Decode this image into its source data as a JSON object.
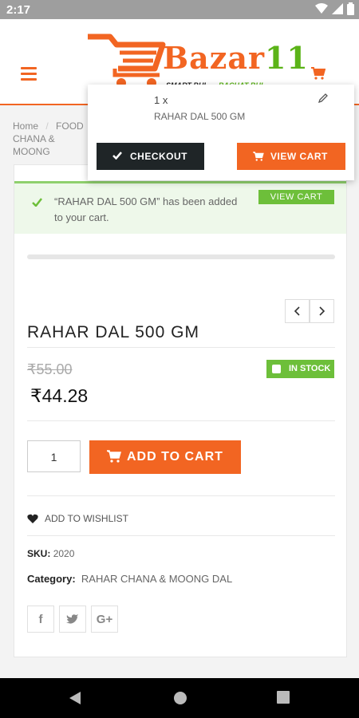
{
  "status": {
    "time": "2:17"
  },
  "brand": {
    "name": "Bazar",
    "number": "11",
    "tagline_left": "SMART BHI",
    "tagline_right": "BACHAT BHI"
  },
  "breadcrumb": {
    "home": "Home",
    "sep": "/",
    "section": "FOOD",
    "category": "CHANA & MOONG"
  },
  "notice": {
    "message": "“RAHAR DAL 500 GM” has been added to your cart.",
    "view_cart": "VIEW CART"
  },
  "product": {
    "title": "RAHAR DAL 500 GM",
    "old_price": "₹55.00",
    "price": "₹44.28",
    "stock": "IN STOCK",
    "quantity": "1",
    "add_to_cart": "ADD TO CART",
    "wishlist": "ADD TO WISHLIST",
    "sku_label": "SKU:",
    "sku": "2020",
    "category_label": "Category:",
    "category": "RAHAR CHANA & MOONG DAL"
  },
  "social": {
    "facebook": "f",
    "twitter": "t",
    "google": "G+"
  },
  "mini_cart": {
    "qty": "1",
    "times": "x",
    "item_name": "RAHAR DAL 500 GM",
    "checkout": "CHECKOUT",
    "view_cart": "VIEW CART"
  },
  "colors": {
    "accent": "#f26522",
    "green": "#6dbf3a",
    "dark": "#1f2527"
  },
  "icons": [
    "wifi-icon",
    "signal-icon",
    "battery-icon",
    "menu-icon",
    "cart-icon",
    "check-icon",
    "chevron-left-icon",
    "chevron-right-icon",
    "heart-icon",
    "facebook-icon",
    "twitter-icon",
    "google-plus-icon",
    "pencil-icon",
    "back-icon",
    "home-icon",
    "recents-icon"
  ]
}
